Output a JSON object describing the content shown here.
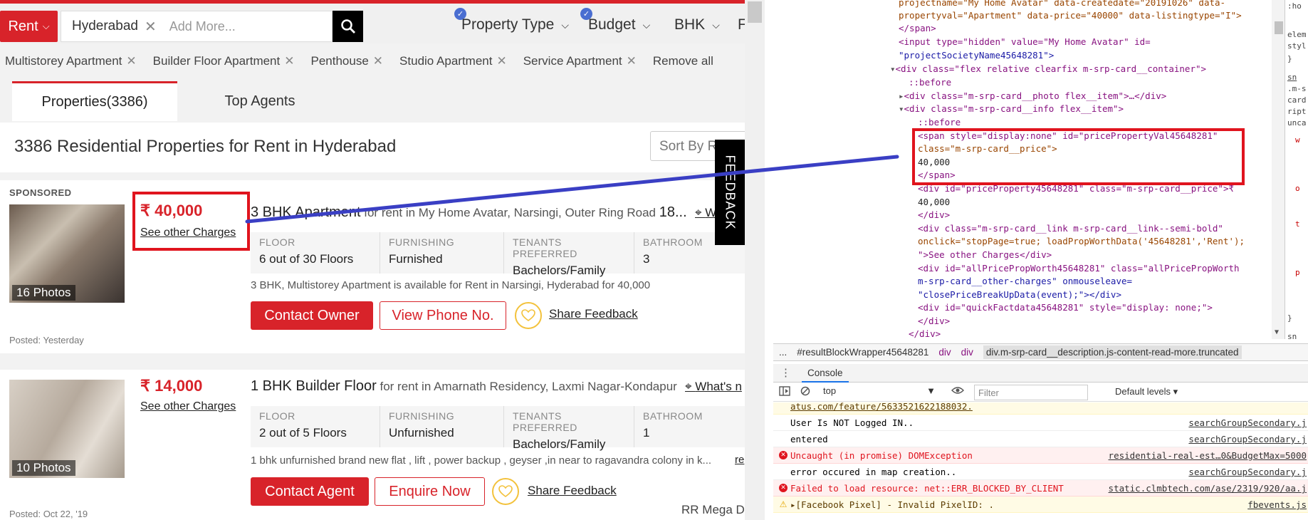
{
  "site": {
    "rent_label": "Rent",
    "search_chip": "Hyderabad",
    "search_placeholder": "Add More...",
    "filters": [
      "Property Type",
      "Budget",
      "BHK",
      "F"
    ],
    "chips": [
      "Multistorey Apartment",
      "Builder Floor Apartment",
      "Penthouse",
      "Studio Apartment",
      "Service Apartment"
    ],
    "remove_all": "Remove all",
    "tab_properties": "Properties(3386)",
    "tab_agents": "Top Agents",
    "results_title": "3386 Residential Properties for Rent in Hyderabad",
    "sort_label": "Sort By R",
    "feedback": "FEEDBACK"
  },
  "cards": [
    {
      "badge": "SPONSORED",
      "photos": "16 Photos",
      "price": "₹ 40,000",
      "charges": "See other Charges",
      "title": "3 BHK Apartment",
      "subtitle": " for rent in My Home Avatar, Narsingi, Outer Ring Road ",
      "title_tail": "18...",
      "whats": "W",
      "facts": [
        {
          "label": "FLOOR",
          "value": "6 out of 30 Floors"
        },
        {
          "label": "FURNISHING",
          "value": "Furnished"
        },
        {
          "label": "TENANTS PREFERRED",
          "value": "Bachelors/Family"
        },
        {
          "label": "BATHROOM",
          "value": "3"
        }
      ],
      "description": "3 BHK, Multistorey Apartment is available for Rent in Narsingi, Hyderabad for 40,000",
      "primary_btn": "Contact Owner",
      "secondary_btn": "View Phone No.",
      "share": "Share Feedback",
      "posted": "Posted: Yesterday"
    },
    {
      "photos": "10 Photos",
      "price": "₹ 14,000",
      "charges": "See other Charges",
      "title": "1 BHK Builder Floor",
      "subtitle": " for rent in Amarnath Residency, Laxmi Nagar-Kondapur",
      "whats": "What's n",
      "facts": [
        {
          "label": "FLOOR",
          "value": "2 out of 5 Floors"
        },
        {
          "label": "FURNISHING",
          "value": "Unfurnished"
        },
        {
          "label": "TENANTS PREFERRED",
          "value": "Bachelors/Family"
        },
        {
          "label": "BATHROOM",
          "value": "1"
        }
      ],
      "description": "1 bhk unfurnished brand new flat , lift , power backup , geyser ,in near to ragavandra colony in k...",
      "read_more": "re",
      "primary_btn": "Contact Agent",
      "secondary_btn": "Enquire Now",
      "share": "Share Feedback",
      "posted": "Posted: Oct 22, '19",
      "agent": "RR Mega Dev"
    }
  ],
  "devtools": {
    "code_lines": [
      "projectname=\"My Home Avatar\" data-createdate=\"20191026\" data-",
      "propertyval=\"Apartment\" data-price=\"40000\" data-listingtype=\"I\">",
      "</span>",
      "<input type=\"hidden\" value=\"My Home Avatar\" id=",
      "\"projectSocietyName45648281\">",
      "<div class=\"flex relative clearfix m-srp-card__container\">",
      "::before",
      "<div class=\"m-srp-card__photo flex__item\">…</div>",
      "<div class=\"m-srp-card__info flex__item\">",
      "::before",
      "<span style=\"display:none\" id=\"pricePropertyVal45648281\"",
      "class=\"m-srp-card__price\">",
      "40,000",
      "</span>",
      "<div id=\"priceProperty45648281\" class=\"m-srp-card__price\">₹",
      "40,000",
      "</div>",
      "<div class=\"m-srp-card__link m-srp-card__link--semi-bold\"",
      "onclick=\"stopPage=true; loadPropWorthData('45648281','Rent');",
      "\">See other Charges</div>",
      "<div id=\"allPricePropWorth45648281\" class=\"allPricePropWorth",
      "m-srp-card__other-charges\" onmouseleave=",
      "\"closePriceBreakUpData(event);\"></div>",
      "<div id=\"quickFactdata45648281\" style=\"display: none;\">",
      "</div>",
      "</div>"
    ],
    "styles_fragments": [
      ":ho",
      "elem",
      "styl",
      "}",
      "sn",
      ".m-s",
      "card",
      "ript",
      "unca",
      "w",
      "o",
      "t",
      "p",
      "}",
      "sn"
    ],
    "crumbs": [
      "...",
      "#resultBlockWrapper45648281",
      "div",
      "div",
      "div.m-srp-card__description.js-content-read-more.truncated"
    ],
    "console_tab": "Console",
    "context": "top",
    "filter_placeholder": "Filter",
    "levels": "Default levels",
    "logs": [
      {
        "type": "warn",
        "msg": "atus.com/feature/5633521622188032.",
        "src": ""
      },
      {
        "type": "info",
        "msg": "User Is NOT Logged IN..",
        "src": "searchGroupSecondary.j"
      },
      {
        "type": "info",
        "msg": "entered",
        "src": "searchGroupSecondary.j"
      },
      {
        "type": "err",
        "msg": "Uncaught (in promise) DOMException",
        "src": "residential-real-est…0&BudgetMax=5000"
      },
      {
        "type": "info",
        "msg": "error occured in map creation..",
        "src": "searchGroupSecondary.j"
      },
      {
        "type": "err",
        "msg": "Failed to load resource: net::ERR_BLOCKED_BY_CLIENT",
        "src": "static.clmbtech.com/ase/2319/920/aa.j"
      },
      {
        "type": "warn",
        "msg": "▸[Facebook Pixel] - Invalid PixelID: .",
        "src": "fbevents.js"
      }
    ]
  },
  "colors": {
    "brand": "#d8232a",
    "highlight": "#e0141e",
    "annotation_arrow": "#3a3fc4"
  }
}
